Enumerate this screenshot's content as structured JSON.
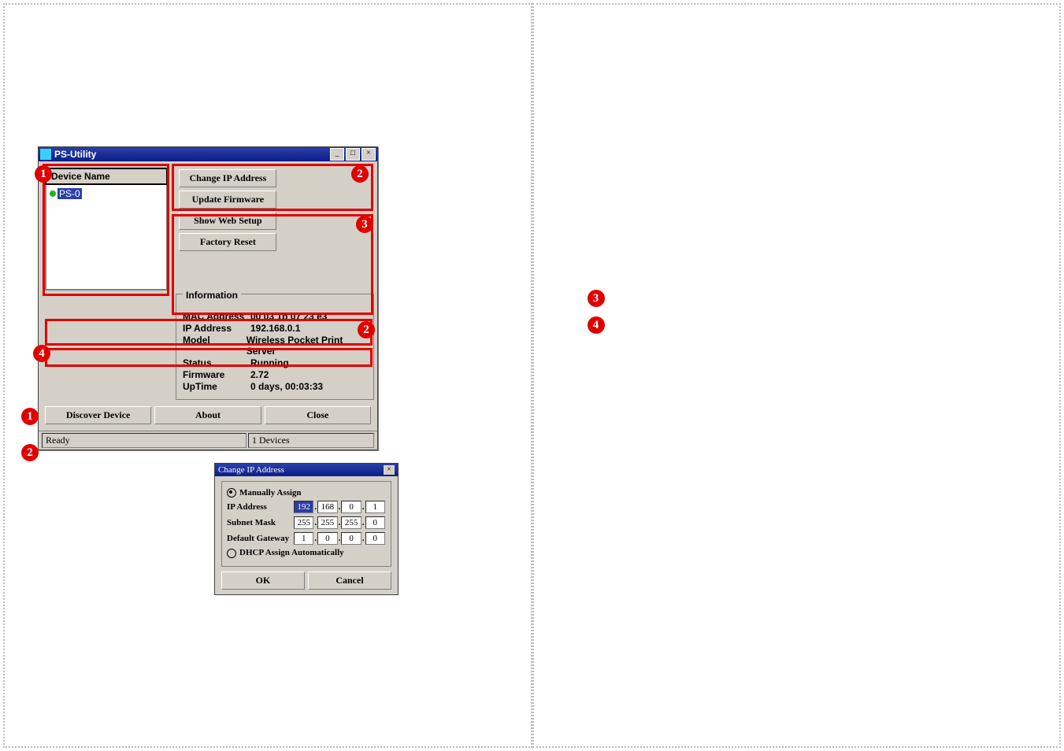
{
  "main_window": {
    "title": "PS-Utility",
    "device_header": "Device Name",
    "device_selected": "PS-0",
    "buttons": {
      "change_ip": "Change IP Address",
      "update_fw": "Update Firmware",
      "show_web": "Show Web Setup",
      "factory_reset": "Factory Reset",
      "discover": "Discover Device",
      "about": "About",
      "close": "Close"
    },
    "info_title": "Information",
    "info": {
      "mac_label": "MAC Address",
      "mac": "00 03 1b 07 23 e3",
      "ip_label": "IP Address",
      "ip": "192.168.0.1",
      "model_label": "Model",
      "model": "Wireless Pocket Print Server",
      "status_label": "Status",
      "status": "Running",
      "fw_label": "Firmware",
      "fw": "2.72",
      "uptime_label": "UpTime",
      "uptime": "0 days, 00:03:33"
    },
    "status_ready": "Ready",
    "status_count": "1 Devices"
  },
  "dialog": {
    "title": "Change IP Address",
    "radio_manual": "Manually Assign",
    "radio_dhcp": "DHCP Assign Automatically",
    "ip_label": "IP Address",
    "ip": [
      "192",
      "168",
      "0",
      "1"
    ],
    "subnet_label": "Subnet Mask",
    "subnet": [
      "255",
      "255",
      "255",
      "0"
    ],
    "gw_label": "Default Gateway",
    "gw": [
      "1",
      "0",
      "0",
      "0"
    ],
    "ok": "OK",
    "cancel": "Cancel"
  },
  "badges": {
    "b1": "1",
    "b2": "2",
    "b3": "3",
    "b4": "4"
  }
}
